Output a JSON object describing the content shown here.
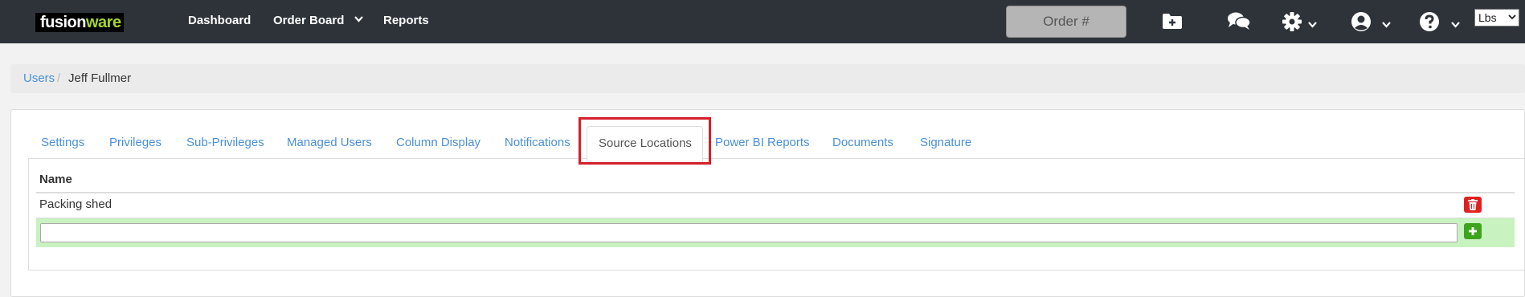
{
  "brand": {
    "logo_part1": "fusion",
    "logo_part2": "ware"
  },
  "nav": {
    "dashboard": "Dashboard",
    "order_board": "Order Board",
    "reports": "Reports"
  },
  "header": {
    "order_placeholder": "Order #",
    "units_selected": "Lbs",
    "icons": [
      "add-folder-icon",
      "chat-icon",
      "gear-icon",
      "user-icon",
      "help-icon"
    ]
  },
  "breadcrumb": {
    "root": "Users",
    "separator": "/",
    "current": "Jeff Fullmer"
  },
  "tabs": {
    "settings": "Settings",
    "privileges": "Privileges",
    "sub_privileges": "Sub-Privileges",
    "managed_users": "Managed Users",
    "column_display": "Column Display",
    "notifications": "Notifications",
    "source_locations": "Source Locations",
    "power_bi": "Power BI Reports",
    "documents": "Documents",
    "signature": "Signature",
    "active": "source_locations"
  },
  "table": {
    "header_name": "Name",
    "rows": [
      {
        "name": "Packing shed"
      }
    ],
    "new_value": ""
  },
  "colors": {
    "topbar": "#2e3339",
    "link": "#4a90d9",
    "highlight": "#d51f2a",
    "delete": "#e21f1f",
    "add": "#3ea41e",
    "add_row_bg": "#c8f2c0"
  }
}
